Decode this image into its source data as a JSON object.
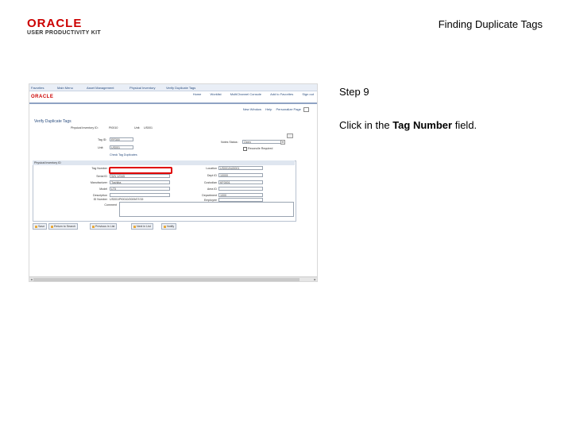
{
  "logo": {
    "brand": "ORACLE",
    "kit": "USER PRODUCTIVITY KIT"
  },
  "doc_title": "Finding Duplicate Tags",
  "step": "Step 9",
  "instruction": {
    "prefix": "Click in the ",
    "bold": "Tag Number",
    "suffix": " field."
  },
  "screenshot": {
    "nav_tabs": [
      "Favorites",
      "Main Menu",
      "Asset Management",
      "Physical Inventory",
      "Verify Duplicate Tags"
    ],
    "top_links": [
      "Home",
      "Worklist",
      "MultiChannel Console",
      "Add to Favorites",
      "Sign out"
    ],
    "sub_links": [
      "New Window",
      "Help",
      "Personalize Page"
    ],
    "page_title": "Verify Duplicate Tags",
    "header": {
      "inv_id_label": "Physical Inventory ID:",
      "inv_id_value": "PI0010",
      "run_label": "Unit:",
      "run_value": "US001",
      "unit_label": "Unit:",
      "unit_value": "US001",
      "tag_label": "Tag ID:",
      "tag_value": "RF300",
      "notes_label": "Notes Status:",
      "notes_value": "Open",
      "recon_label": "Reconcile Required",
      "link_text": "Check Tag Duplicates"
    },
    "group_title": "Physical Inventory ID",
    "fields_left": [
      {
        "label": "Tag Number",
        "value": ""
      },
      {
        "label": "Serial ID",
        "value": "S/N 12345"
      },
      {
        "label": "Manufacturer",
        "value": "Toshiba"
      },
      {
        "label": "Model",
        "value": "LT5"
      },
      {
        "label": "Description",
        "value": ""
      },
      {
        "label": "ID Number",
        "value": "US001/PI0010/2009/07/15"
      }
    ],
    "fields_right": [
      {
        "label": "Location",
        "value": "US001/NJ0001"
      },
      {
        "label": "Dept ID",
        "value": "10000"
      },
      {
        "label": "Custodian",
        "value": "KF0001"
      },
      {
        "label": "Area ID",
        "value": ""
      },
      {
        "label": "Department",
        "value": "1000"
      },
      {
        "label": "Employee",
        "value": ""
      }
    ],
    "comment_label": "Comment",
    "buttons": [
      "Save",
      "Return to Search",
      "Previous in List",
      "Next in List",
      "Notify"
    ]
  }
}
